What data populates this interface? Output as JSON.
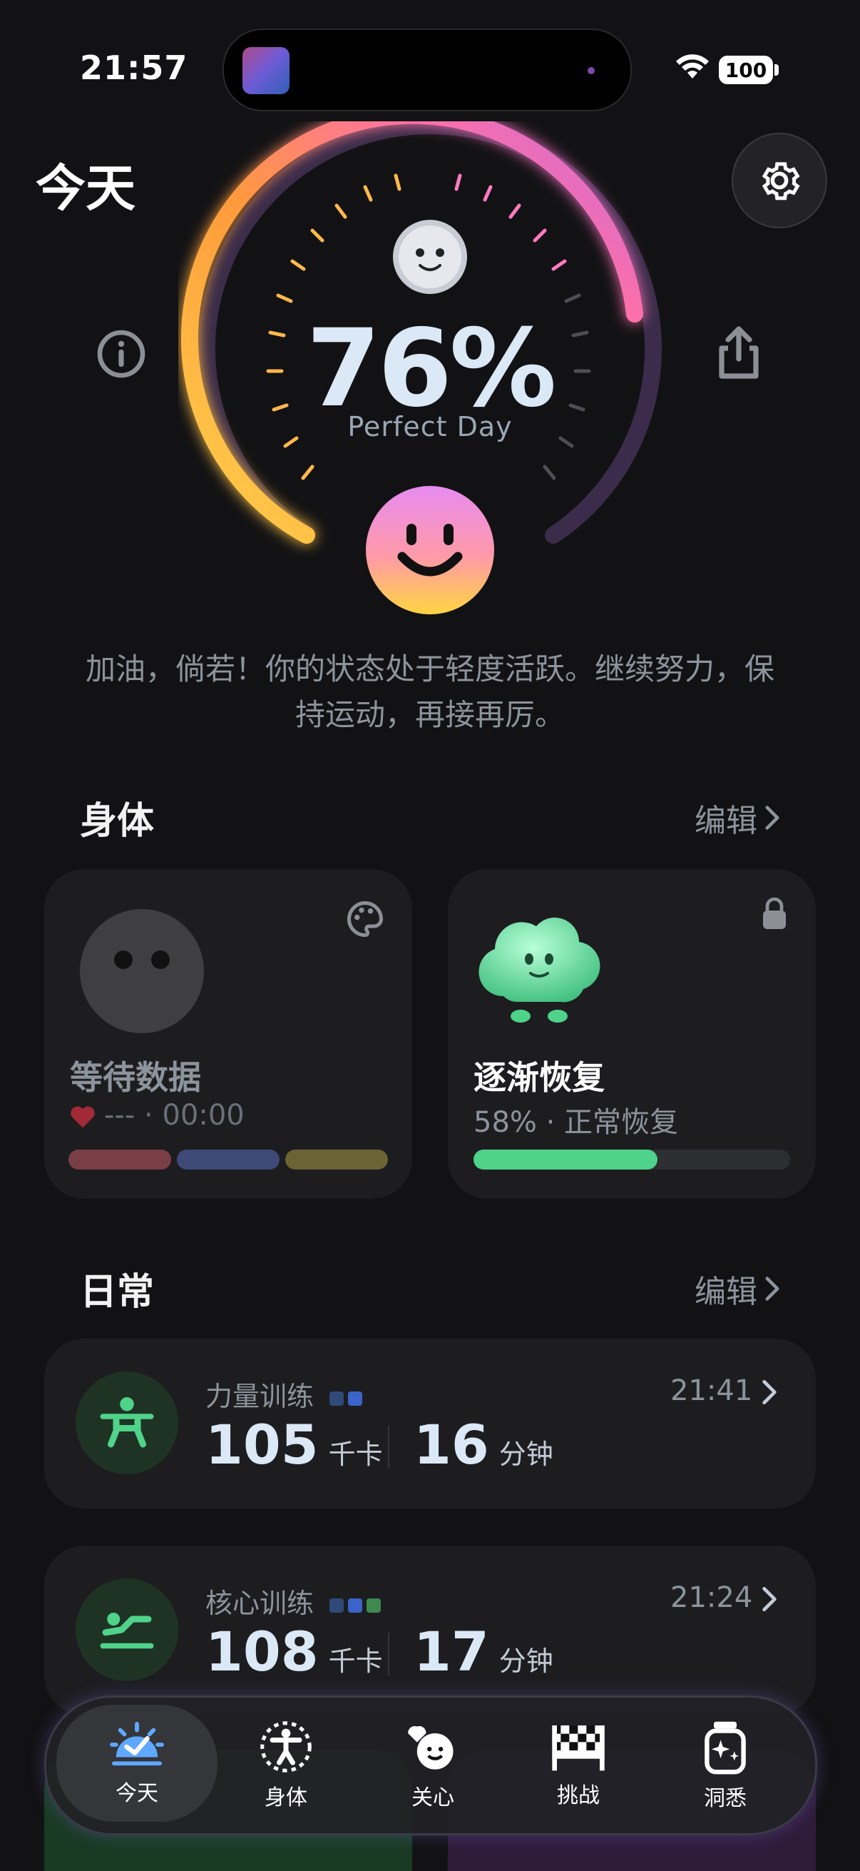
{
  "status": {
    "time": "21:57",
    "battery": "100"
  },
  "header": {
    "title": "今天"
  },
  "score": {
    "percent": "76%",
    "label": "Perfect Day",
    "value": 0.76
  },
  "message": "加油，倘若！你的状态处于轻度活跃。继续努力，保持运动，再接再厉。",
  "body_section": {
    "title": "身体",
    "edit": "编辑",
    "cards": [
      {
        "title": "等待数据",
        "subtitle": "--- · 00:00"
      },
      {
        "title": "逐渐恢复",
        "subtitle": "58% · 正常恢复",
        "progress": 0.58
      }
    ]
  },
  "daily_section": {
    "title": "日常",
    "edit": "编辑",
    "activities": [
      {
        "name": "力量训练",
        "time": "21:41",
        "kcal": "105",
        "kcal_unit": "千卡",
        "minutes": "16",
        "minutes_unit": "分钟"
      },
      {
        "name": "核心训练",
        "time": "21:24",
        "kcal": "108",
        "kcal_unit": "千卡",
        "minutes": "17",
        "minutes_unit": "分钟"
      }
    ]
  },
  "tabs": [
    {
      "label": "今天",
      "active": true
    },
    {
      "label": "身体"
    },
    {
      "label": "关心"
    },
    {
      "label": "挑战"
    },
    {
      "label": "洞悉"
    }
  ],
  "colors": {
    "accent_green": "#4fd38a",
    "gauge_yellow": "#ffd24a",
    "gauge_purple": "#c46cd9"
  }
}
